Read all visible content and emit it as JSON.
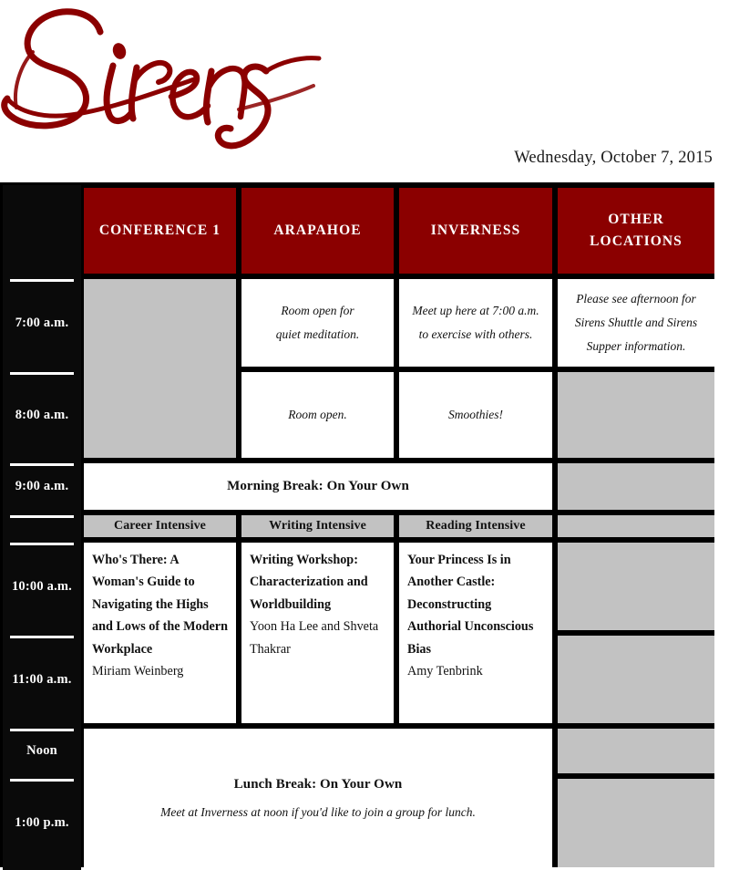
{
  "masthead": {
    "logo_text": "Sirens",
    "logo_icon": "sirens-script-wordmark",
    "date": "Wednesday, October 7, 2015",
    "brand_color": "#8b0000"
  },
  "colors": {
    "header_red": "#8b0000",
    "time_black": "#0a0a0a",
    "empty_gray": "#c2c2c2",
    "cell_white": "#ffffff"
  },
  "schedule": {
    "columns": [
      {
        "label": "",
        "name": "time-column"
      },
      {
        "label": "CONFERENCE 1",
        "name": "conference-1"
      },
      {
        "label": "ARAPAHOE",
        "name": "arapahoe"
      },
      {
        "label": "INVERNESS",
        "name": "inverness"
      },
      {
        "label": "OTHER LOCATIONS",
        "name": "other-locations",
        "line1": "OTHER",
        "line2": "LOCATIONS"
      }
    ],
    "times": {
      "t0700": "7:00 a.m.",
      "t0800": "8:00 a.m.",
      "t0900": "9:00 a.m.",
      "t_track": "",
      "t1000": "10:00 a.m.",
      "t1100": "11:00 a.m.",
      "noon": "Noon",
      "t1300": "1:00 p.m."
    },
    "row_0700": {
      "arapahoe_line1": "Room open for",
      "arapahoe_line2": "quiet meditation.",
      "inverness_line1": "Meet up here at 7:00 a.m.",
      "inverness_line2": "to exercise with others.",
      "other_line1": "Please see afternoon for",
      "other_line2": "Sirens Shuttle and Sirens",
      "other_line3": "Supper information."
    },
    "row_0800": {
      "arapahoe": "Room open.",
      "inverness": "Smoothies!"
    },
    "row_0900": {
      "break_title": "Morning Break: On Your Own"
    },
    "tracks": {
      "conference1": "Career Intensive",
      "arapahoe": "Writing Intensive",
      "inverness": "Reading Intensive"
    },
    "sessions": {
      "conference1": {
        "title": "Who's There: A Woman's Guide to Navigating the Highs and Lows of the Modern Workplace",
        "presenter": "Miriam Weinberg"
      },
      "arapahoe": {
        "title": "Writing Workshop: Characterization and Worldbuilding",
        "presenter": "Yoon Ha Lee and Shveta Thakrar"
      },
      "inverness": {
        "title": "Your Princess Is in Another Castle: Deconstructing Authorial Unconscious Bias",
        "presenter": "Amy Tenbrink"
      }
    },
    "lunch": {
      "break_title": "Lunch Break: On Your Own",
      "break_sub": "Meet at Inverness at noon if you'd like to join a group for lunch."
    }
  }
}
